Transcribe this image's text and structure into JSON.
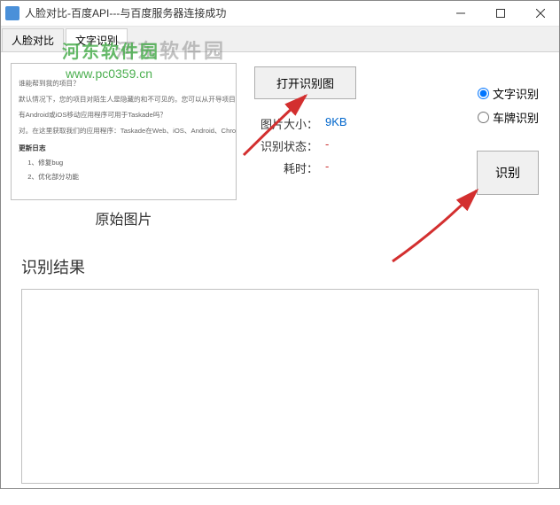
{
  "titlebar": {
    "text": "人脸对比-百度API---与百度服务器连接成功"
  },
  "tabs": {
    "t1": "人脸对比",
    "t2": "文字识别"
  },
  "watermark": {
    "brand": "河东软件园",
    "url": "www.pc0359.cn"
  },
  "preview": {
    "caption": "原始图片",
    "l1": "谁能帮到我的项目？",
    "l2": "默认情况下，您的项目对陌生人是隐藏的和不可见的。您可以从开导项目成员和工作区以与工作做协作。",
    "l3": "有Android或iOS移动应用程序可用于Taskade吗？",
    "l4": "对。在这里获取我们的应用程序：Taskade在Web、iOS、Android、Chrome、Firefox、PC和Mac上",
    "h1": "更新日志",
    "i1": "1、修复bug",
    "i2": "2、优化部分功能"
  },
  "buttons": {
    "open": "打开识别图",
    "recognize": "识别"
  },
  "info": {
    "size_label": "图片大小：",
    "size_val": "9KB",
    "status_label": "识别状态：",
    "status_val": "-",
    "time_label": "耗时：",
    "time_val": "-"
  },
  "radios": {
    "text": "文字识别",
    "plate": "车牌识别"
  },
  "result": {
    "title": "识别结果"
  }
}
